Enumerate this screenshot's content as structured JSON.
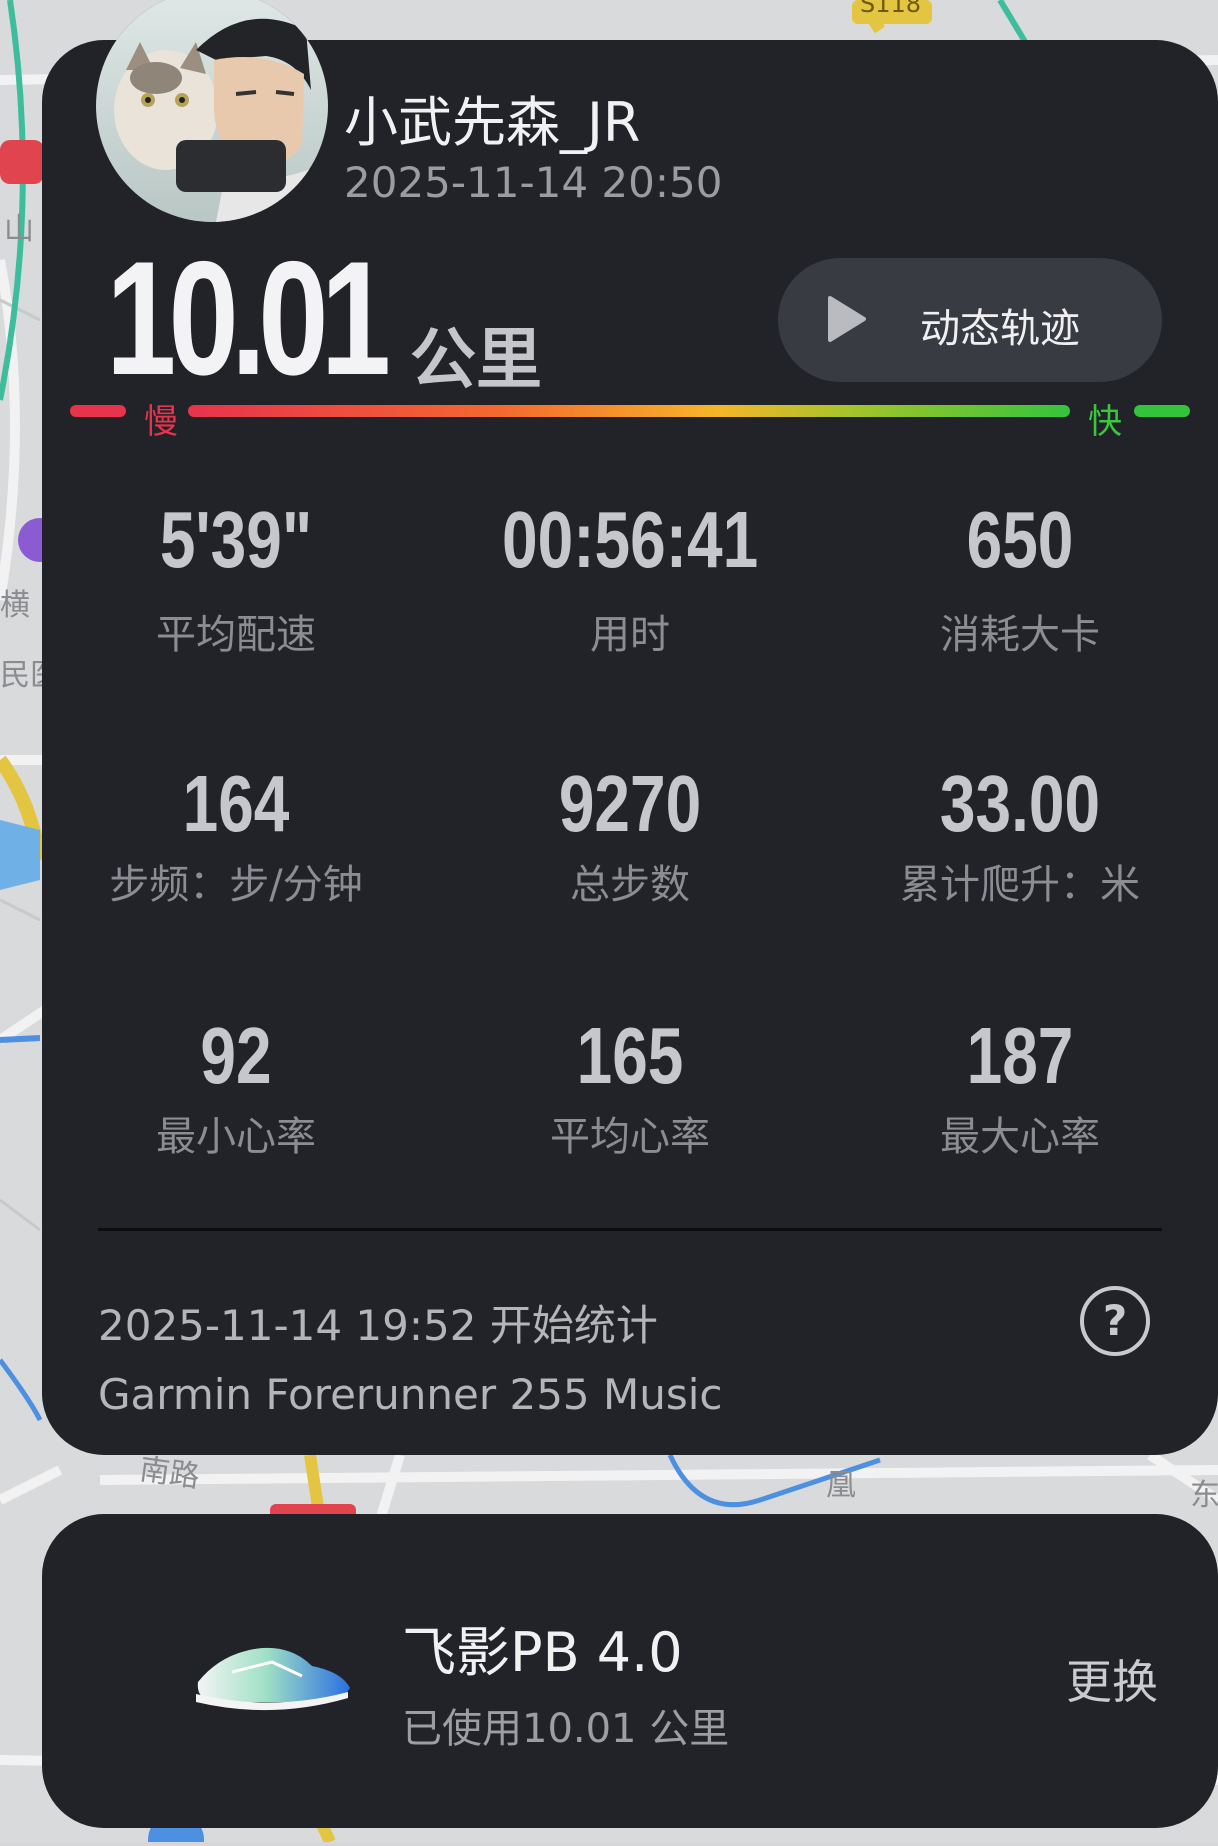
{
  "user": {
    "name": "小武先森_JR",
    "datetime": "2025-11-14 20:50"
  },
  "run": {
    "distance": "10.01",
    "unit": "公里"
  },
  "track_button": {
    "label": "动态轨迹",
    "icon": "play-icon"
  },
  "speed_legend": {
    "slow": "慢",
    "fast": "快"
  },
  "stats": [
    {
      "value": "5'39\"",
      "label": "平均配速"
    },
    {
      "value": "00:56:41",
      "label": "用时"
    },
    {
      "value": "650",
      "label": "消耗大卡"
    },
    {
      "value": "164",
      "label": "步频：步/分钟"
    },
    {
      "value": "9270",
      "label": "总步数"
    },
    {
      "value": "33.00",
      "label": "累计爬升：米"
    },
    {
      "value": "92",
      "label": "最小心率"
    },
    {
      "value": "165",
      "label": "平均心率"
    },
    {
      "value": "187",
      "label": "最大心率"
    }
  ],
  "footer": {
    "start": "2025-11-14 19:52  开始统计",
    "device": "Garmin Forerunner 255 Music",
    "help_icon": "question-icon"
  },
  "shoe": {
    "name": "飞影PB 4.0",
    "used": "已使用10.01 公里",
    "change": "更换"
  },
  "map_labels": [
    "S118",
    "山",
    "横",
    "民医",
    "南路",
    "凰",
    "东"
  ],
  "colors": {
    "card_bg": "#212328",
    "map_bg": "#d6d7d9",
    "slow": "#e8334d",
    "fast": "#39c83a"
  }
}
